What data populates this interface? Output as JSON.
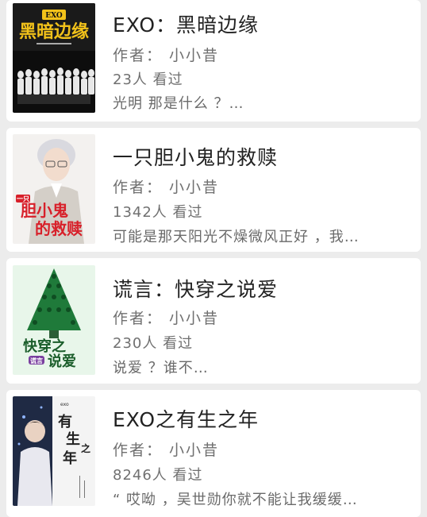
{
  "books": [
    {
      "title": "EXO：黑暗边缘",
      "author": "作者： 小小昔",
      "views": "23人 看过",
      "desc": "光明 那是什么 ？…",
      "cover_text": "黑暗边缘",
      "cover_badge": "EXO"
    },
    {
      "title": "一只胆小鬼的救赎",
      "author": "作者： 小小昔",
      "views": "1342人 看过",
      "desc": "可能是那天阳光不燥微风正好 ，我…",
      "cover_text_1": "胆小鬼",
      "cover_text_2": "的救赎",
      "cover_badge": "一只"
    },
    {
      "title": "谎言：快穿之说爱",
      "author": "作者： 小小昔",
      "views": "230人 看过",
      "desc": "说爱 ？谁不…",
      "cover_text_1": "快穿之",
      "cover_text_2": "说爱",
      "cover_badge": "谎言"
    },
    {
      "title": "EXO之有生之年",
      "author": "作者： 小小昔",
      "views": "8246人 看过",
      "desc": "“ 哎呦 ，吴世勋你就不能让我缓缓…",
      "cover_text_1": "有",
      "cover_text_2": "生",
      "cover_text_3": "之",
      "cover_text_4": "年",
      "cover_badge": "exo"
    }
  ],
  "colors": {
    "background": "#ececec",
    "card": "#ffffff",
    "title": "#222222",
    "meta": "#707070",
    "cover1_title": "#f2c21a",
    "cover2_title": "#d8202a",
    "cover3_bg": "#e8f6ea",
    "cover3_tree": "#1f7a3a",
    "cover3_title": "#1b5e2b",
    "cover4_bg": "#f4f4f4"
  }
}
